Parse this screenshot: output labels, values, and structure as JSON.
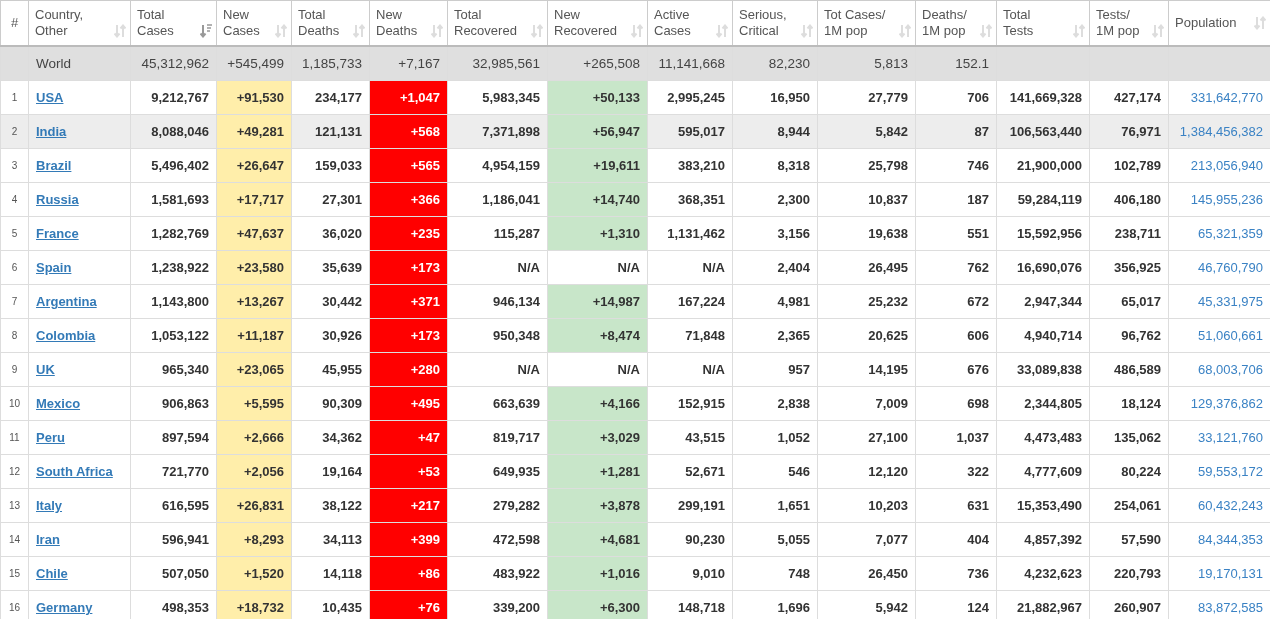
{
  "table": {
    "columns": [
      {
        "label": "#"
      },
      {
        "label": "Country,\nOther",
        "sorted": false
      },
      {
        "label": "Total\nCases",
        "sorted": true
      },
      {
        "label": "New\nCases",
        "sorted": false
      },
      {
        "label": "Total\nDeaths",
        "sorted": false
      },
      {
        "label": "New\nDeaths",
        "sorted": false
      },
      {
        "label": "Total\nRecovered",
        "sorted": false
      },
      {
        "label": "New\nRecovered",
        "sorted": false
      },
      {
        "label": "Active\nCases",
        "sorted": false
      },
      {
        "label": "Serious,\nCritical",
        "sorted": false
      },
      {
        "label": "Tot Cases/\n1M pop",
        "sorted": false
      },
      {
        "label": "Deaths/\n1M pop",
        "sorted": false
      },
      {
        "label": "Total\nTests",
        "sorted": false
      },
      {
        "label": "Tests/\n1M pop",
        "sorted": false
      },
      {
        "label": "Population",
        "sorted": false
      }
    ],
    "world": {
      "label": "World",
      "values": [
        "45,312,962",
        "+545,499",
        "1,185,733",
        "+7,167",
        "32,985,561",
        "+265,508",
        "11,141,668",
        "82,230",
        "5,813",
        "152.1"
      ]
    },
    "rows": [
      {
        "highlighted": false,
        "recovered_marked": true,
        "cells": [
          "1",
          "USA",
          "9,212,767",
          "+91,530",
          "234,177",
          "+1,047",
          "5,983,345",
          "+50,133",
          "2,995,245",
          "16,950",
          "27,779",
          "706",
          "141,669,328",
          "427,174",
          "331,642,770"
        ]
      },
      {
        "highlighted": true,
        "recovered_marked": true,
        "cells": [
          "2",
          "India",
          "8,088,046",
          "+49,281",
          "121,131",
          "+568",
          "7,371,898",
          "+56,947",
          "595,017",
          "8,944",
          "5,842",
          "87",
          "106,563,440",
          "76,971",
          "1,384,456,382"
        ]
      },
      {
        "highlighted": false,
        "recovered_marked": true,
        "cells": [
          "3",
          "Brazil",
          "5,496,402",
          "+26,647",
          "159,033",
          "+565",
          "4,954,159",
          "+19,611",
          "383,210",
          "8,318",
          "25,798",
          "746",
          "21,900,000",
          "102,789",
          "213,056,940"
        ]
      },
      {
        "highlighted": false,
        "recovered_marked": true,
        "cells": [
          "4",
          "Russia",
          "1,581,693",
          "+17,717",
          "27,301",
          "+366",
          "1,186,041",
          "+14,740",
          "368,351",
          "2,300",
          "10,837",
          "187",
          "59,284,119",
          "406,180",
          "145,955,236"
        ]
      },
      {
        "highlighted": false,
        "recovered_marked": true,
        "cells": [
          "5",
          "France",
          "1,282,769",
          "+47,637",
          "36,020",
          "+235",
          "115,287",
          "+1,310",
          "1,131,462",
          "3,156",
          "19,638",
          "551",
          "15,592,956",
          "238,711",
          "65,321,359"
        ]
      },
      {
        "highlighted": false,
        "recovered_marked": false,
        "cells": [
          "6",
          "Spain",
          "1,238,922",
          "+23,580",
          "35,639",
          "+173",
          "N/A",
          "N/A",
          "N/A",
          "2,404",
          "26,495",
          "762",
          "16,690,076",
          "356,925",
          "46,760,790"
        ]
      },
      {
        "highlighted": false,
        "recovered_marked": true,
        "cells": [
          "7",
          "Argentina",
          "1,143,800",
          "+13,267",
          "30,442",
          "+371",
          "946,134",
          "+14,987",
          "167,224",
          "4,981",
          "25,232",
          "672",
          "2,947,344",
          "65,017",
          "45,331,975"
        ]
      },
      {
        "highlighted": false,
        "recovered_marked": true,
        "cells": [
          "8",
          "Colombia",
          "1,053,122",
          "+11,187",
          "30,926",
          "+173",
          "950,348",
          "+8,474",
          "71,848",
          "2,365",
          "20,625",
          "606",
          "4,940,714",
          "96,762",
          "51,060,661"
        ]
      },
      {
        "highlighted": false,
        "recovered_marked": false,
        "cells": [
          "9",
          "UK",
          "965,340",
          "+23,065",
          "45,955",
          "+280",
          "N/A",
          "N/A",
          "N/A",
          "957",
          "14,195",
          "676",
          "33,089,838",
          "486,589",
          "68,003,706"
        ]
      },
      {
        "highlighted": false,
        "recovered_marked": true,
        "cells": [
          "10",
          "Mexico",
          "906,863",
          "+5,595",
          "90,309",
          "+495",
          "663,639",
          "+4,166",
          "152,915",
          "2,838",
          "7,009",
          "698",
          "2,344,805",
          "18,124",
          "129,376,862"
        ]
      },
      {
        "highlighted": false,
        "recovered_marked": true,
        "cells": [
          "11",
          "Peru",
          "897,594",
          "+2,666",
          "34,362",
          "+47",
          "819,717",
          "+3,029",
          "43,515",
          "1,052",
          "27,100",
          "1,037",
          "4,473,483",
          "135,062",
          "33,121,760"
        ]
      },
      {
        "highlighted": false,
        "recovered_marked": true,
        "cells": [
          "12",
          "South Africa",
          "721,770",
          "+2,056",
          "19,164",
          "+53",
          "649,935",
          "+1,281",
          "52,671",
          "546",
          "12,120",
          "322",
          "4,777,609",
          "80,224",
          "59,553,172"
        ]
      },
      {
        "highlighted": false,
        "recovered_marked": true,
        "cells": [
          "13",
          "Italy",
          "616,595",
          "+26,831",
          "38,122",
          "+217",
          "279,282",
          "+3,878",
          "299,191",
          "1,651",
          "10,203",
          "631",
          "15,353,490",
          "254,061",
          "60,432,243"
        ]
      },
      {
        "highlighted": false,
        "recovered_marked": true,
        "cells": [
          "14",
          "Iran",
          "596,941",
          "+8,293",
          "34,113",
          "+399",
          "472,598",
          "+4,681",
          "90,230",
          "5,055",
          "7,077",
          "404",
          "4,857,392",
          "57,590",
          "84,344,353"
        ]
      },
      {
        "highlighted": false,
        "recovered_marked": true,
        "cells": [
          "15",
          "Chile",
          "507,050",
          "+1,520",
          "14,118",
          "+86",
          "483,922",
          "+1,016",
          "9,010",
          "748",
          "26,450",
          "736",
          "4,232,623",
          "220,793",
          "19,170,131"
        ]
      },
      {
        "highlighted": false,
        "recovered_marked": true,
        "cells": [
          "16",
          "Germany",
          "498,353",
          "+18,732",
          "10,435",
          "+76",
          "339,200",
          "+6,300",
          "148,718",
          "1,696",
          "5,942",
          "124",
          "21,882,967",
          "260,907",
          "83,872,585"
        ]
      }
    ]
  }
}
